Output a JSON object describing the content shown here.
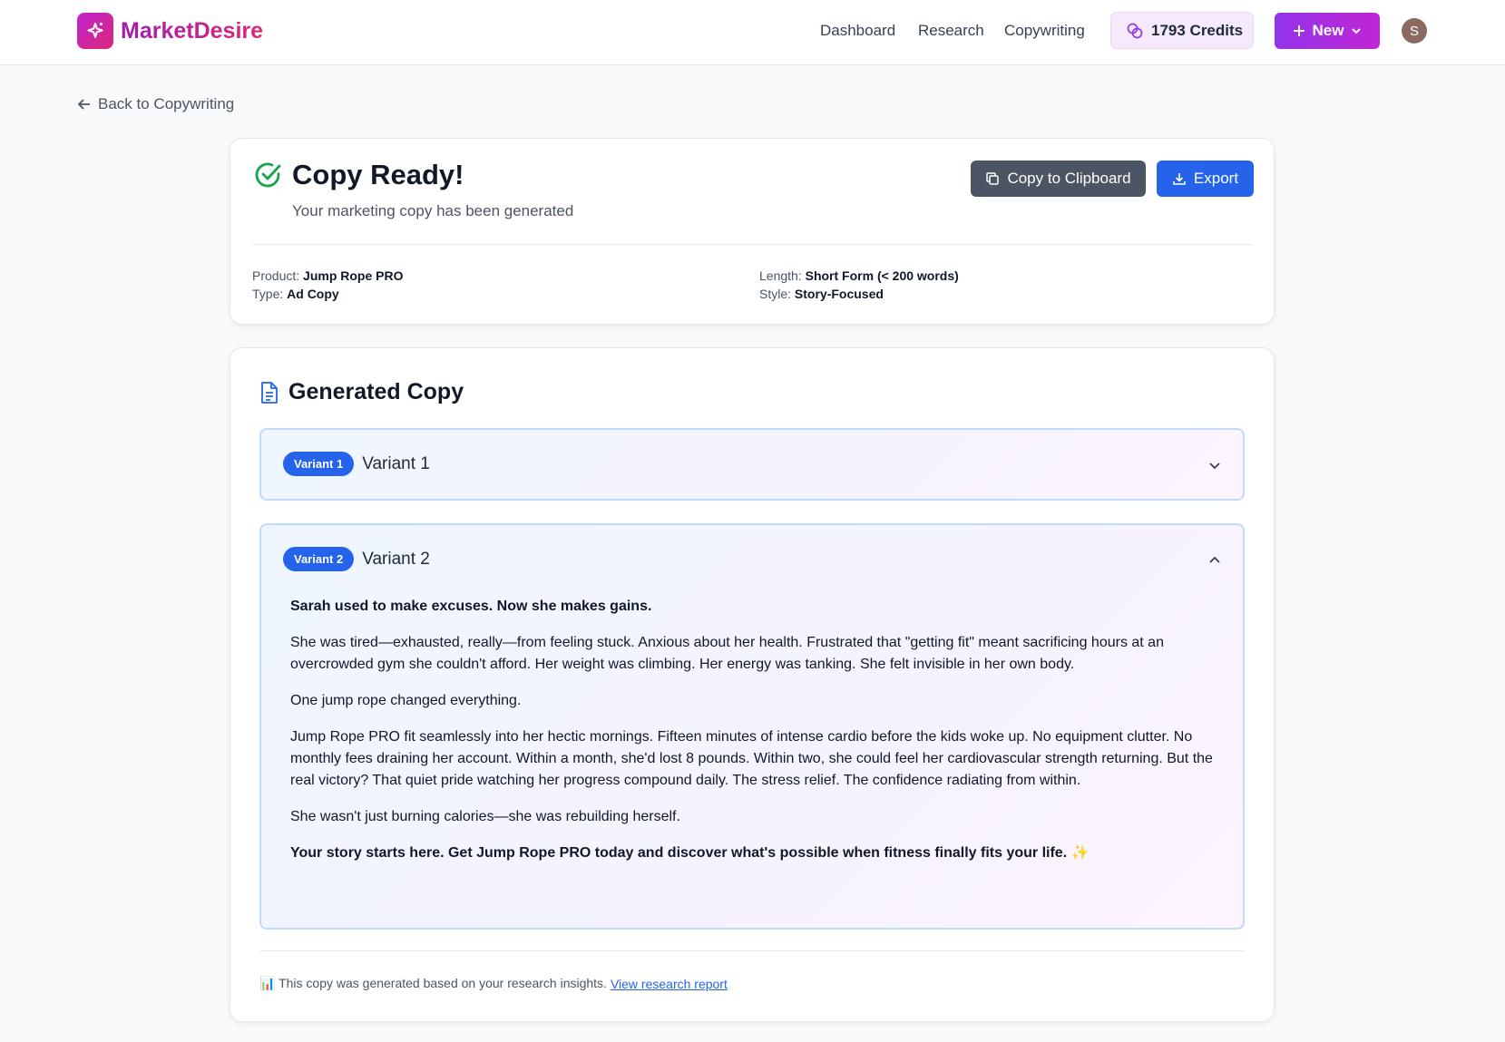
{
  "brand": {
    "name": "MarketDesire",
    "logo_icon": "sparkles-icon"
  },
  "nav": {
    "links": [
      "Dashboard",
      "Research",
      "Copywriting"
    ]
  },
  "credits": {
    "label": "1793 Credits"
  },
  "new_button": {
    "label": "New"
  },
  "avatar": {
    "initial": "S"
  },
  "back_link": {
    "label": "Back to Copywriting"
  },
  "summary": {
    "title": "Copy Ready!",
    "subtitle": "Your marketing copy has been generated",
    "copy_button": "Copy to Clipboard",
    "export_button": "Export",
    "product_label": "Product:",
    "product_value": "Jump Rope PRO",
    "type_label": "Type:",
    "type_value": "Ad Copy",
    "length_label": "Length:",
    "length_value": "Short Form (< 200 words)",
    "style_label": "Style:",
    "style_value": "Story-Focused"
  },
  "generated": {
    "title": "Generated Copy",
    "variants": [
      {
        "badge": "Variant 1",
        "name": "Variant 1",
        "expanded": false
      },
      {
        "badge": "Variant 2",
        "name": "Variant 2",
        "expanded": true,
        "paragraphs": [
          "Sarah used to make excuses. Now she makes gains.",
          "She was tired—exhausted, really—from feeling stuck. Anxious about her health. Frustrated that \"getting fit\" meant sacrificing hours at an overcrowded gym she couldn't afford. Her weight was climbing. Her energy was tanking. She felt invisible in her own body.",
          "One jump rope changed everything.",
          "Jump Rope PRO fit seamlessly into her hectic mornings. Fifteen minutes of intense cardio before the kids woke up. No equipment clutter. No monthly fees draining her account. Within a month, she'd lost 8 pounds. Within two, she could feel her cardiovascular strength returning. But the real victory? That quiet pride watching her progress compound daily. The stress relief. The confidence radiating from within.",
          "She wasn't just burning calories—she was rebuilding herself.",
          "Your story starts here. Get Jump Rope PRO today and discover what's possible when fitness finally fits your life. ✨"
        ]
      }
    ],
    "footer_text": "📊 This copy was generated based on your research insights.",
    "footer_link": "View research report"
  },
  "colors": {
    "primary": "#2563eb",
    "brand_from": "#c026d3",
    "brand_to": "#db2777",
    "success": "#16a34a"
  }
}
